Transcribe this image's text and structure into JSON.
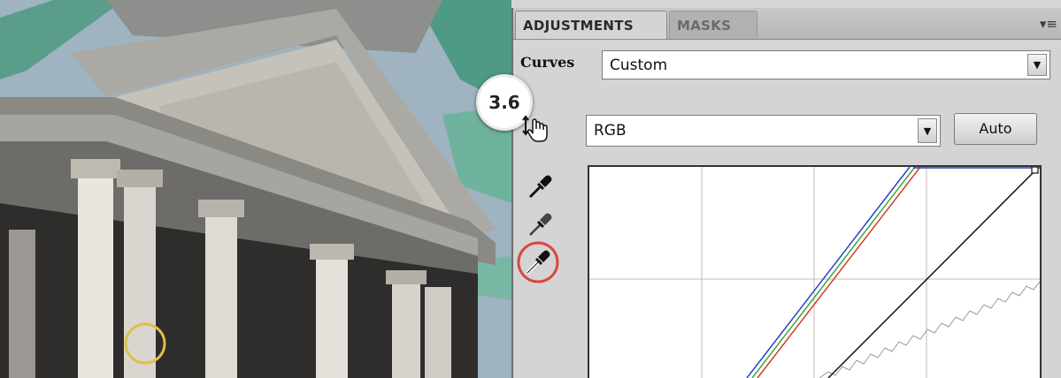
{
  "panel": {
    "tabs": [
      {
        "label": "ADJUSTMENTS",
        "active": true
      },
      {
        "label": "MASKS",
        "active": false
      }
    ],
    "menu_icon": "panel-menu-icon",
    "adjustment_label": "Curves",
    "preset": {
      "value": "Custom"
    },
    "channel": {
      "value": "RGB"
    },
    "auto_label": "Auto",
    "tools": [
      {
        "icon": "on-image-adjust-hand-icon"
      },
      {
        "icon": "black-point-eyedropper-icon"
      },
      {
        "icon": "gray-point-eyedropper-icon"
      },
      {
        "icon": "white-point-eyedropper-icon",
        "highlighted": true
      }
    ]
  },
  "callout": {
    "label": "3.6"
  },
  "photo": {
    "subject": "neoclassical-building-facade",
    "marker_color": "#e0c040"
  },
  "graph": {
    "grid": true,
    "curve_colors": {
      "red": "#d43a2a",
      "green": "#3aa83a",
      "blue": "#2b3fc4",
      "composite": "#111111"
    },
    "highlight_color": "#d9483c"
  }
}
